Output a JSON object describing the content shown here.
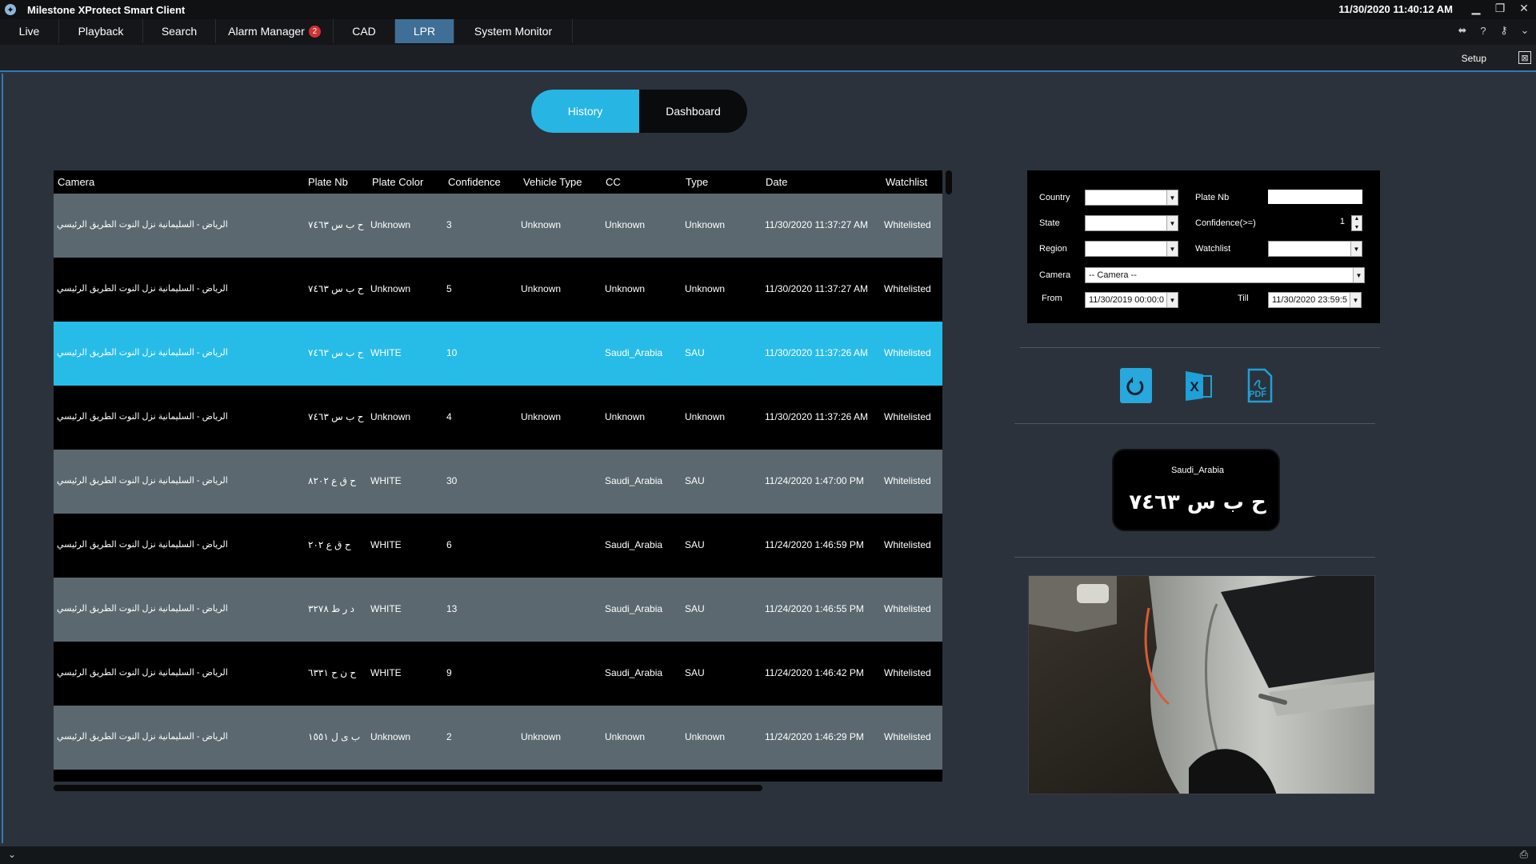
{
  "window": {
    "title": "Milestone XProtect Smart Client",
    "clock": "11/30/2020 11:40:12 AM"
  },
  "menu": {
    "tabs": [
      {
        "label": "Live"
      },
      {
        "label": "Playback"
      },
      {
        "label": "Search"
      },
      {
        "label": "Alarm Manager",
        "badge": "2"
      },
      {
        "label": "CAD"
      },
      {
        "label": "LPR",
        "active": true
      },
      {
        "label": "System Monitor"
      }
    ]
  },
  "toolbar": {
    "setup_label": "Setup"
  },
  "segments": {
    "history": "History",
    "dashboard": "Dashboard",
    "selected": "History"
  },
  "table": {
    "headers": {
      "camera": "Camera",
      "plate": "Plate Nb",
      "color": "Plate Color",
      "confidence": "Confidence",
      "vehicle": "Vehicle Type",
      "cc": "CC",
      "type": "Type",
      "date": "Date",
      "watchlist": "Watchlist"
    },
    "rows": [
      {
        "camera": "الرياض - السليمانية نزل النوت الطريق الرئيسي",
        "plate": "ح ب س ٧٤٦٣",
        "color": "Unknown",
        "confidence": "3",
        "vehicle": "Unknown",
        "cc": "Unknown",
        "type": "Unknown",
        "date": "11/30/2020 11:37:27 AM",
        "watchlist": "Whitelisted"
      },
      {
        "camera": "الرياض - السليمانية نزل النوت الطريق الرئيسي",
        "plate": "ح ب س ٧٤٦٣",
        "color": "Unknown",
        "confidence": "5",
        "vehicle": "Unknown",
        "cc": "Unknown",
        "type": "Unknown",
        "date": "11/30/2020 11:37:27 AM",
        "watchlist": "Whitelisted"
      },
      {
        "camera": "الرياض - السليمانية نزل النوت الطريق الرئيسي",
        "plate": "ح ب س ٧٤٦٣",
        "color": "WHITE",
        "confidence": "10",
        "vehicle": "",
        "cc": "Saudi_Arabia",
        "type": "SAU",
        "date": "11/30/2020 11:37:26 AM",
        "watchlist": "Whitelisted",
        "selected": true
      },
      {
        "camera": "الرياض - السليمانية نزل النوت الطريق الرئيسي",
        "plate": "ح ب س ٧٤٦٣",
        "color": "Unknown",
        "confidence": "4",
        "vehicle": "Unknown",
        "cc": "Unknown",
        "type": "Unknown",
        "date": "11/30/2020 11:37:26 AM",
        "watchlist": "Whitelisted"
      },
      {
        "camera": "الرياض - السليمانية نزل النوت الطريق الرئيسي",
        "plate": "ح ق ع ٨٢٠٢",
        "color": "WHITE",
        "confidence": "30",
        "vehicle": "",
        "cc": "Saudi_Arabia",
        "type": "SAU",
        "date": "11/24/2020 1:47:00 PM",
        "watchlist": "Whitelisted"
      },
      {
        "camera": "الرياض - السليمانية نزل النوت الطريق الرئيسي",
        "plate": "ح ق ع ٢٠٢",
        "color": "WHITE",
        "confidence": "6",
        "vehicle": "",
        "cc": "Saudi_Arabia",
        "type": "SAU",
        "date": "11/24/2020 1:46:59 PM",
        "watchlist": "Whitelisted"
      },
      {
        "camera": "الرياض - السليمانية نزل النوت الطريق الرئيسي",
        "plate": "د ر ط ٣٢٧٨",
        "color": "WHITE",
        "confidence": "13",
        "vehicle": "",
        "cc": "Saudi_Arabia",
        "type": "SAU",
        "date": "11/24/2020 1:46:55 PM",
        "watchlist": "Whitelisted"
      },
      {
        "camera": "الرياض - السليمانية نزل النوت الطريق الرئيسي",
        "plate": "ح ن ح ٦٣٣١",
        "color": "WHITE",
        "confidence": "9",
        "vehicle": "",
        "cc": "Saudi_Arabia",
        "type": "SAU",
        "date": "11/24/2020 1:46:42 PM",
        "watchlist": "Whitelisted"
      },
      {
        "camera": "الرياض - السليمانية نزل النوت الطريق الرئيسي",
        "plate": "ب ى ل ١٥٥١",
        "color": "Unknown",
        "confidence": "2",
        "vehicle": "Unknown",
        "cc": "Unknown",
        "type": "Unknown",
        "date": "11/24/2020 1:46:29 PM",
        "watchlist": "Whitelisted"
      }
    ]
  },
  "filter": {
    "country_label": "Country",
    "state_label": "State",
    "region_label": "Region",
    "camera_label": "Camera",
    "from_label": "From",
    "till_label": "Till",
    "plate_label": "Plate Nb",
    "confidence_label": "Confidence(>=)",
    "confidence_value": "1",
    "watchlist_label": "Watchlist",
    "camera_value": "-- Camera --",
    "from_value": "11/30/2019 00:00:0",
    "till_value": "11/30/2020 23:59:5"
  },
  "exports": {
    "refresh_icon": "refresh-icon",
    "excel_icon": "excel-icon",
    "pdf_text": "PDF"
  },
  "plate_card": {
    "country": "Saudi_Arabia",
    "number": "ح ب س ٧٤٦٣"
  },
  "colors": {
    "accent": "#27b6e4",
    "active_tab": "#3f6f96",
    "row_light": "#5b6870",
    "badge": "#d43131"
  }
}
